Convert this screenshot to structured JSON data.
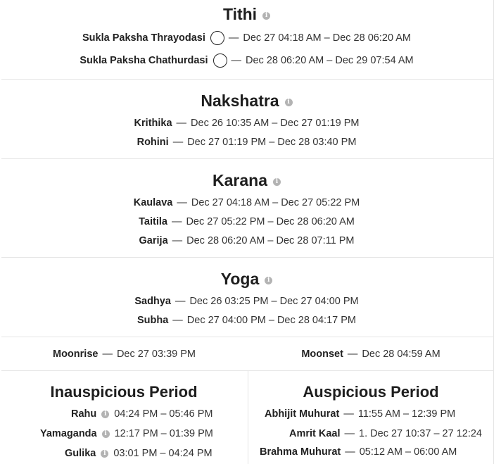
{
  "tithi": {
    "title": "Tithi",
    "rows": [
      {
        "name": "Sukla Paksha Thrayodasi",
        "range": "Dec 27 04:18 AM – Dec 28 06:20 AM"
      },
      {
        "name": "Sukla Paksha Chathurdasi",
        "range": "Dec 28 06:20 AM – Dec 29 07:54 AM"
      }
    ]
  },
  "nakshatra": {
    "title": "Nakshatra",
    "rows": [
      {
        "name": "Krithika",
        "range": "Dec 26 10:35 AM – Dec 27 01:19 PM"
      },
      {
        "name": "Rohini",
        "range": "Dec 27 01:19 PM – Dec 28 03:40 PM"
      }
    ]
  },
  "karana": {
    "title": "Karana",
    "rows": [
      {
        "name": "Kaulava",
        "range": "Dec 27 04:18 AM – Dec 27 05:22 PM"
      },
      {
        "name": "Taitila",
        "range": "Dec 27 05:22 PM – Dec 28 06:20 AM"
      },
      {
        "name": "Garija",
        "range": "Dec 28 06:20 AM – Dec 28 07:11 PM"
      }
    ]
  },
  "yoga": {
    "title": "Yoga",
    "rows": [
      {
        "name": "Sadhya",
        "range": "Dec 26 03:25 PM – Dec 27 04:00 PM"
      },
      {
        "name": "Subha",
        "range": "Dec 27 04:00 PM – Dec 28 04:17 PM"
      }
    ]
  },
  "moon": {
    "moonrise_label": "Moonrise",
    "moonrise_value": "Dec 27 03:39 PM",
    "moonset_label": "Moonset",
    "moonset_value": "Dec 28 04:59 AM"
  },
  "inauspicious": {
    "title": "Inauspicious Period",
    "rows": [
      {
        "name": "Rahu",
        "range": "04:24 PM – 05:46 PM"
      },
      {
        "name": "Yamaganda",
        "range": "12:17 PM – 01:39 PM"
      },
      {
        "name": "Gulika",
        "range": "03:01 PM – 04:24 PM"
      }
    ]
  },
  "auspicious": {
    "title": "Auspicious Period",
    "rows": [
      {
        "name": "Abhijit Muhurat",
        "range": "11:55 AM – 12:39 PM"
      },
      {
        "name": "Amrit Kaal",
        "range": "1. Dec 27 10:37 – 27 12:24"
      },
      {
        "name": "Brahma Muhurat",
        "range": "05:12 AM – 06:00 AM"
      }
    ]
  },
  "separator": "—",
  "info_glyph": "i",
  "icons": {
    "info": "info-icon",
    "moon_phase": "moon-phase-icon"
  }
}
